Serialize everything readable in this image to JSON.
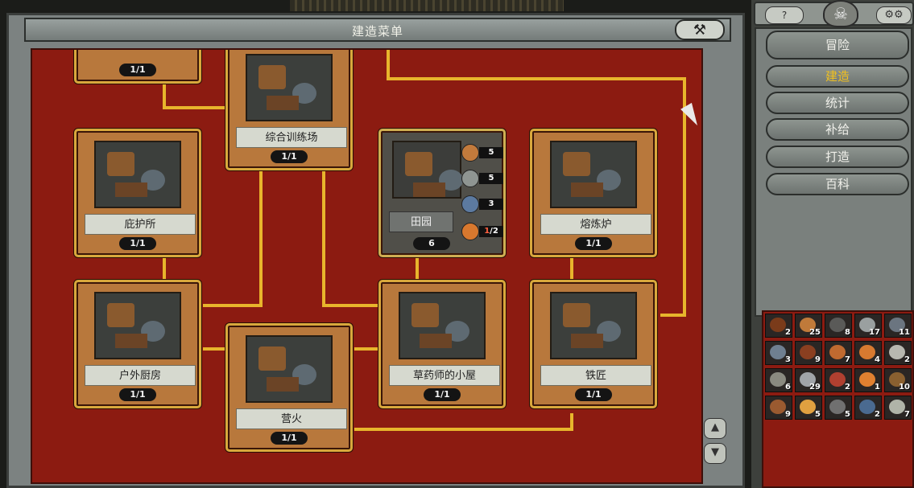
{
  "window": {
    "title": "建造菜单",
    "close_icon": "hammer-cross-icon"
  },
  "buildings": [
    {
      "id": "top-partial",
      "name": "",
      "level": "1/1"
    },
    {
      "id": "training-ground",
      "name": "综合训练场",
      "level": "1/1"
    },
    {
      "id": "shelter",
      "name": "庇护所",
      "level": "1/1"
    },
    {
      "id": "farm",
      "name": "田园",
      "level": "6",
      "resources": [
        {
          "icon": "wood-icon",
          "value": "5"
        },
        {
          "icon": "stone-icon",
          "value": "5"
        },
        {
          "icon": "orb-icon",
          "value": "3"
        },
        {
          "icon": "food-orb-icon",
          "value": "1",
          "max": "/2"
        }
      ]
    },
    {
      "id": "smelter",
      "name": "熔炼炉",
      "level": "1/1"
    },
    {
      "id": "kitchen",
      "name": "户外厨房",
      "level": "1/1"
    },
    {
      "id": "campfire",
      "name": "营火",
      "level": "1/1"
    },
    {
      "id": "herbalist",
      "name": "草药师的小屋",
      "level": "1/1"
    },
    {
      "id": "smith",
      "name": "铁匠",
      "level": "1/1"
    }
  ],
  "side": {
    "help_label": "?",
    "nav": [
      {
        "label": "冒险",
        "active": false
      },
      {
        "label": "建造",
        "active": true
      },
      {
        "label": "统计",
        "active": false
      },
      {
        "label": "补给",
        "active": false
      },
      {
        "label": "打造",
        "active": false
      },
      {
        "label": "百科",
        "active": false
      }
    ]
  },
  "inventory": [
    {
      "icon": "branch-icon",
      "count": "2",
      "color": "#7a3b1a"
    },
    {
      "icon": "wood-icon",
      "count": "25",
      "color": "#c07a3a"
    },
    {
      "icon": "rock-icon",
      "count": "8",
      "color": "#5a5a58"
    },
    {
      "icon": "metal-icon",
      "count": "17",
      "color": "#9aa0a0"
    },
    {
      "icon": "shard-icon",
      "count": "11",
      "color": "#6b7580"
    },
    {
      "icon": "stone-orb-icon",
      "count": "3",
      "color": "#6f7f90"
    },
    {
      "icon": "root-icon",
      "count": "9",
      "color": "#8a3f20"
    },
    {
      "icon": "mushroom-icon",
      "count": "7",
      "color": "#c06a30"
    },
    {
      "icon": "food-orb-icon",
      "count": "4",
      "color": "#d87a30"
    },
    {
      "icon": "skull-icon",
      "count": "2",
      "color": "#b8b8b0"
    },
    {
      "icon": "scrap-icon",
      "count": "6",
      "color": "#8a8a80"
    },
    {
      "icon": "book-icon",
      "count": "29",
      "color": "#a0a4a8"
    },
    {
      "icon": "flesh-icon",
      "count": "2",
      "color": "#b04030"
    },
    {
      "icon": "ember-icon",
      "count": "1",
      "color": "#e08030"
    },
    {
      "icon": "gear-item-icon",
      "count": "10",
      "color": "#8a6030"
    },
    {
      "icon": "pickaxe-icon",
      "count": "9",
      "color": "#9a5a30"
    },
    {
      "icon": "sun-orb-icon",
      "count": "5",
      "color": "#e0a040"
    },
    {
      "icon": "ore-icon",
      "count": "5",
      "color": "#707070"
    },
    {
      "icon": "blue-orb-icon",
      "count": "2",
      "color": "#4a6a90"
    },
    {
      "icon": "chain-icon",
      "count": "7",
      "color": "#b0b4a8"
    }
  ],
  "colors": {
    "board": "#8c1b11",
    "wire": "#e8b52c",
    "active_nav": "#f0c020"
  }
}
